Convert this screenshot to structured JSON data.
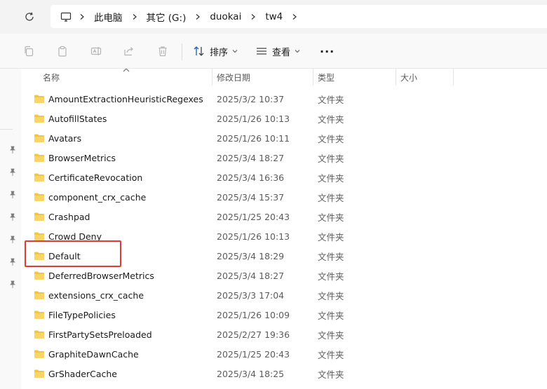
{
  "address": {
    "refresh_icon": "refresh-icon",
    "pc_icon": "computer-icon",
    "crumbs": [
      "此电脑",
      "其它 (G:)",
      "duokai",
      "tw4"
    ]
  },
  "toolbar": {
    "icons": [
      "copy-icon",
      "paste-icon",
      "rename-icon",
      "share-icon",
      "delete-icon"
    ],
    "sort_label": "排序",
    "view_label": "查看",
    "more_label": "···"
  },
  "columns": {
    "name": "名称",
    "date": "修改日期",
    "type": "类型",
    "size": "大小"
  },
  "files": [
    {
      "name": "AmountExtractionHeuristicRegexes",
      "date": "2025/3/2 10:37",
      "type": "文件夹"
    },
    {
      "name": "AutofillStates",
      "date": "2025/1/26 10:13",
      "type": "文件夹"
    },
    {
      "name": "Avatars",
      "date": "2025/1/26 10:11",
      "type": "文件夹"
    },
    {
      "name": "BrowserMetrics",
      "date": "2025/3/4 18:27",
      "type": "文件夹"
    },
    {
      "name": "CertificateRevocation",
      "date": "2025/3/4 16:36",
      "type": "文件夹"
    },
    {
      "name": "component_crx_cache",
      "date": "2025/3/4 15:37",
      "type": "文件夹"
    },
    {
      "name": "Crashpad",
      "date": "2025/1/25 20:43",
      "type": "文件夹"
    },
    {
      "name": "Crowd Deny",
      "date": "2025/1/26 10:13",
      "type": "文件夹"
    },
    {
      "name": "Default",
      "date": "2025/3/4 18:29",
      "type": "文件夹"
    },
    {
      "name": "DeferredBrowserMetrics",
      "date": "2025/3/4 18:27",
      "type": "文件夹"
    },
    {
      "name": "extensions_crx_cache",
      "date": "2025/3/3 17:04",
      "type": "文件夹"
    },
    {
      "name": "FileTypePolicies",
      "date": "2025/1/26 10:09",
      "type": "文件夹"
    },
    {
      "name": "FirstPartySetsPreloaded",
      "date": "2025/2/27 19:36",
      "type": "文件夹"
    },
    {
      "name": "GraphiteDawnCache",
      "date": "2025/1/25 20:43",
      "type": "文件夹"
    },
    {
      "name": "GrShaderCache",
      "date": "2025/3/4 18:25",
      "type": "文件夹"
    }
  ],
  "colors": {
    "folder": "#f4c542",
    "highlight": "#e53935"
  }
}
